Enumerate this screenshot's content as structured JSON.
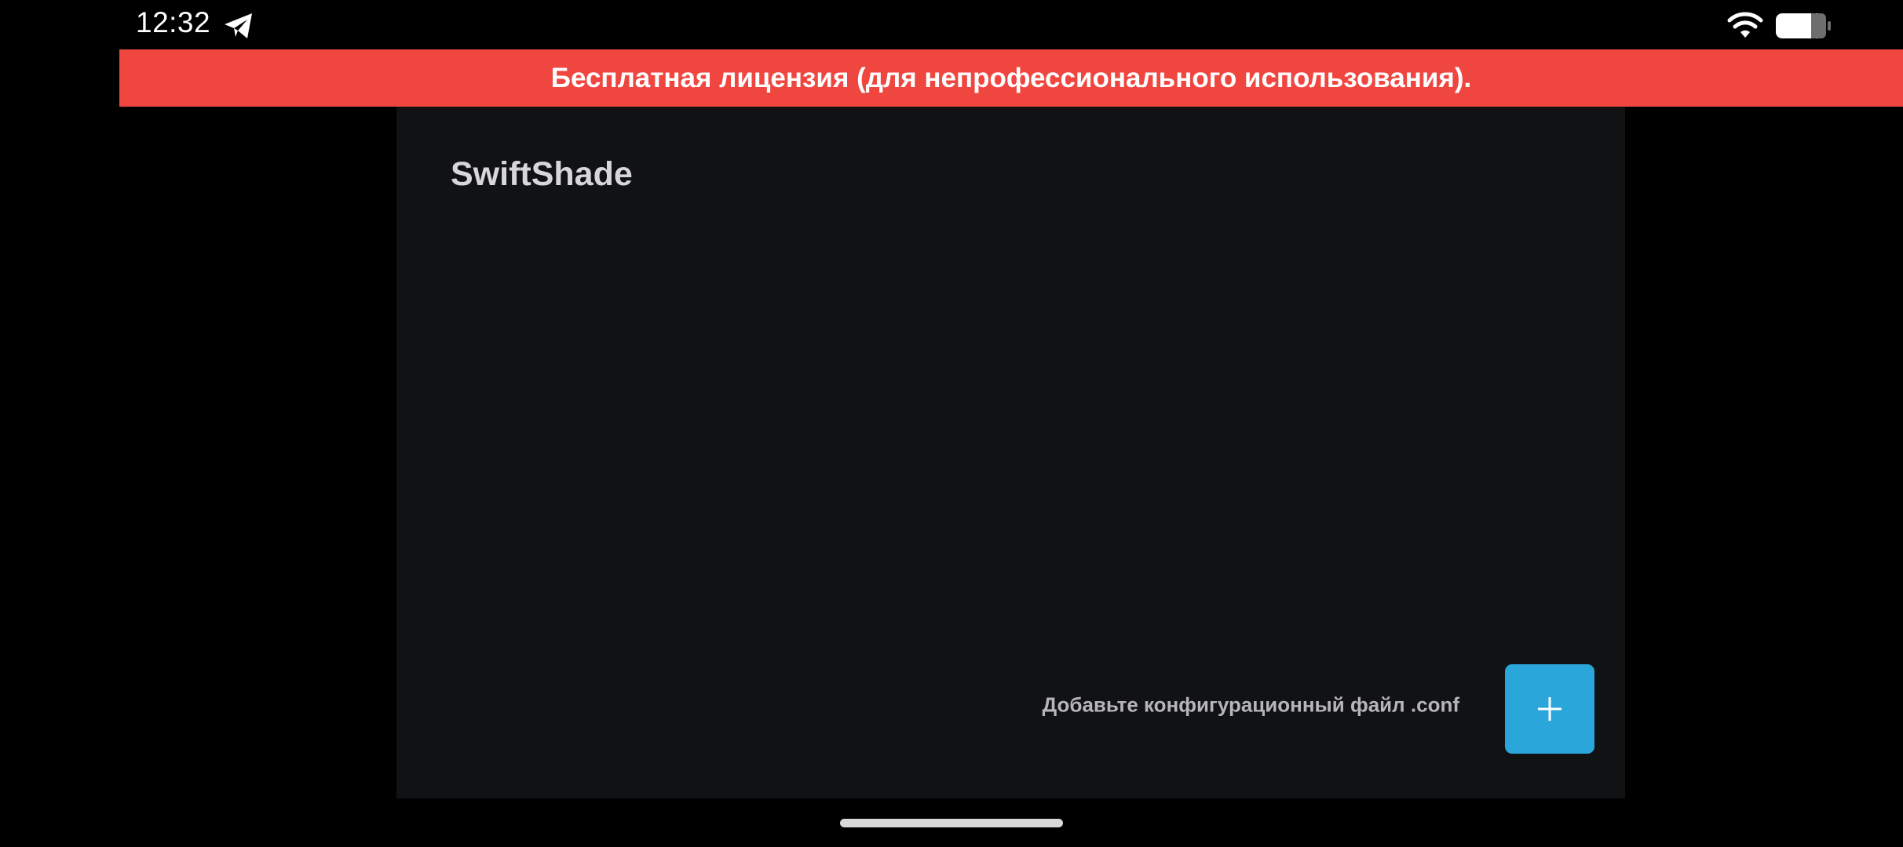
{
  "status_bar": {
    "time": "12:32",
    "icons": [
      "telegram-icon",
      "wifi-icon",
      "battery-icon"
    ]
  },
  "banner": {
    "text": "Бесплатная лицензия (для непрофессионального использования).",
    "color": "#ef4640"
  },
  "app": {
    "title": "SwiftShade",
    "add_hint": "Добавьте конфигурационный файл .conf",
    "add_button_icon": "plus-icon",
    "accent_color": "#2aa6db",
    "background_color": "#111214"
  }
}
